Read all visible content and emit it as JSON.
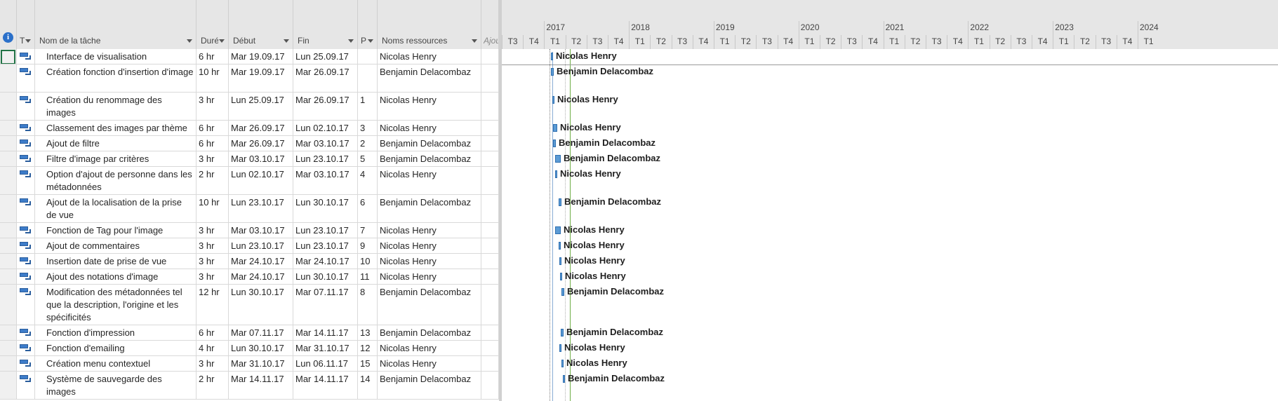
{
  "headers": {
    "indicators_icon": "info-icon",
    "mode_short": "T",
    "task_name": "Nom de la tâche",
    "duration": "Durée",
    "start": "Début",
    "finish": "Fin",
    "predecessors": "P",
    "resources": "Noms ressources",
    "add_column": "Ajouter une nouvelle colonne"
  },
  "tasks": [
    {
      "name": "Interface de visualisation",
      "duration": "6 hr",
      "start": "Mar 19.09.17",
      "finish": "Lun 25.09.17",
      "pred": "",
      "resource": "Nicolas Henry"
    },
    {
      "name": "Création fonction d'insertion d'image",
      "duration": "10 hr",
      "start": "Mar 19.09.17",
      "finish": "Mar 26.09.17",
      "pred": "",
      "resource": "Benjamin Delacombaz"
    },
    {
      "name": "Création du renommage des images",
      "duration": "3 hr",
      "start": "Lun 25.09.17",
      "finish": "Mar 26.09.17",
      "pred": "1",
      "resource": "Nicolas Henry"
    },
    {
      "name": "Classement des images par thème",
      "duration": "6 hr",
      "start": "Mar 26.09.17",
      "finish": "Lun 02.10.17",
      "pred": "3",
      "resource": "Nicolas Henry"
    },
    {
      "name": "Ajout de filtre",
      "duration": "6 hr",
      "start": "Mar 26.09.17",
      "finish": "Mar 03.10.17",
      "pred": "2",
      "resource": "Benjamin Delacombaz"
    },
    {
      "name": "Filtre d'image par critères",
      "duration": "3 hr",
      "start": "Mar 03.10.17",
      "finish": "Lun 23.10.17",
      "pred": "5",
      "resource": "Benjamin Delacombaz"
    },
    {
      "name": "Option d'ajout de personne dans les métadonnées",
      "duration": "2 hr",
      "start": "Lun 02.10.17",
      "finish": "Mar 03.10.17",
      "pred": "4",
      "resource": "Nicolas Henry"
    },
    {
      "name": "Ajout de la localisation de la prise de vue",
      "duration": "10 hr",
      "start": "Lun 23.10.17",
      "finish": "Lun 30.10.17",
      "pred": "6",
      "resource": "Benjamin Delacombaz"
    },
    {
      "name": "Fonction de Tag pour l'image",
      "duration": "3 hr",
      "start": "Mar 03.10.17",
      "finish": "Lun 23.10.17",
      "pred": "7",
      "resource": "Nicolas Henry"
    },
    {
      "name": "Ajout de commentaires",
      "duration": "3 hr",
      "start": "Lun 23.10.17",
      "finish": "Lun 23.10.17",
      "pred": "9",
      "resource": "Nicolas Henry"
    },
    {
      "name": "Insertion date de prise de vue",
      "duration": "3 hr",
      "start": "Mar 24.10.17",
      "finish": "Mar 24.10.17",
      "pred": "10",
      "resource": "Nicolas Henry"
    },
    {
      "name": "Ajout des notations d'image",
      "duration": "3 hr",
      "start": "Mar 24.10.17",
      "finish": "Lun 30.10.17",
      "pred": "11",
      "resource": "Nicolas Henry"
    },
    {
      "name": "Modification des métadonnées tel que la description, l'origine et les spécificités",
      "duration": "12 hr",
      "start": "Lun 30.10.17",
      "finish": "Mar 07.11.17",
      "pred": "8",
      "resource": "Benjamin Delacombaz"
    },
    {
      "name": "Fonction d'impression",
      "duration": "6 hr",
      "start": "Mar 07.11.17",
      "finish": "Mar 14.11.17",
      "pred": "13",
      "resource": "Benjamin Delacombaz"
    },
    {
      "name": "Fonction d'emailing",
      "duration": "4 hr",
      "start": "Lun 30.10.17",
      "finish": "Mar 31.10.17",
      "pred": "12",
      "resource": "Nicolas Henry"
    },
    {
      "name": "Création menu contextuel",
      "duration": "3 hr",
      "start": "Mar 31.10.17",
      "finish": "Lun 06.11.17",
      "pred": "15",
      "resource": "Nicolas Henry"
    },
    {
      "name": "Système de sauvegarde des images",
      "duration": "2 hr",
      "start": "Mar 14.11.17",
      "finish": "Mar 14.11.17",
      "pred": "14",
      "resource": "Benjamin Delacombaz"
    }
  ],
  "timeline": {
    "years": [
      "2017",
      "2018",
      "2019",
      "2020",
      "2021",
      "2022",
      "2023",
      "2024"
    ],
    "quarters": [
      "T3",
      "T4",
      "T1",
      "T2",
      "T3",
      "T4",
      "T1",
      "T2",
      "T3",
      "T4",
      "T1",
      "T2",
      "T3",
      "T4",
      "T1",
      "T2",
      "T3",
      "T4",
      "T1",
      "T2",
      "T3",
      "T4",
      "T1",
      "T2",
      "T3",
      "T4",
      "T1",
      "T2",
      "T3",
      "T4",
      "T1"
    ]
  },
  "colors": {
    "task_bar": "#5b9bd5",
    "selection": "#217346",
    "info_icon": "#2b70c9",
    "header_bg": "#e6e6e6"
  }
}
